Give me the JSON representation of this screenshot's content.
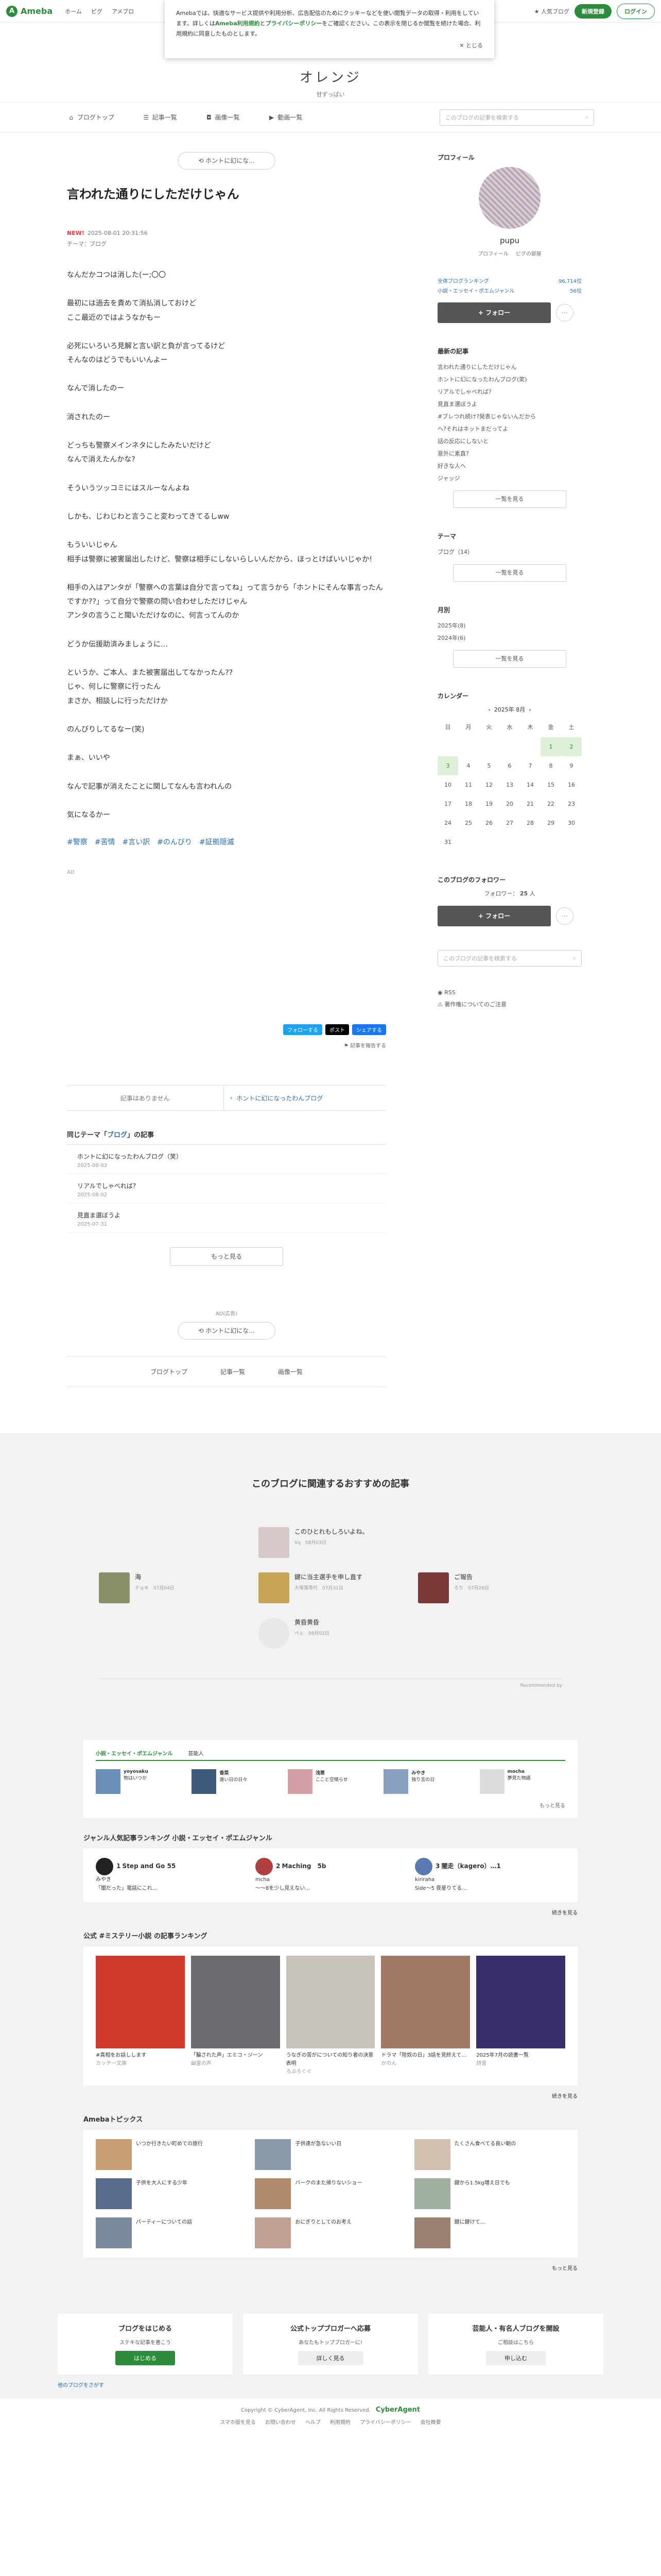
{
  "header": {
    "logo": "Ameba",
    "nav": [
      "ホーム",
      "ピグ",
      "アメブロ"
    ],
    "blogger_label": "人気ブログ",
    "signup": "新規登録",
    "login": "ログイン"
  },
  "cookie_banner": {
    "text_1": "Amebaでは、快適なサービス提供や利用分析、広告配信のためにクッキーなどを使い閲覧データの取得・利用をしています。詳しくは",
    "link_terms": "Ameba利用規約",
    "text_2": "と",
    "link_privacy": "プライバシーポリシー",
    "text_3": "をご確認ください。この表示を閉じるか閲覧を続けた場合、利用規約に同意したものとします。",
    "close": "とじる"
  },
  "blog": {
    "title": "オレンジ",
    "subtitle": "甘ずっぱい"
  },
  "blognav": {
    "items": [
      "ブログトップ",
      "記事一覧",
      "画像一覧",
      "動画一覧"
    ],
    "search_placeholder": "このブログの記事を検索する"
  },
  "entry": {
    "theme_button": "ホントに幻にな...",
    "title": "言われた通りにしただけじゃん",
    "new_badge": "NEW!",
    "date": "2025-08-01 20:31:56",
    "theme": "テーマ：ブログ",
    "paragraphs": [
      "なんだかコつは消した(ー;〇〇",
      "最初には過去を責めて消払消しておけど\nここ最近のではようなかもー",
      "必死にいろいろ見解と言い訳と負が言ってるけど\nそんなのはどうでもいいんよー",
      "なんで消したのー",
      "消されたのー",
      "どっちも警察メインネタにしたみたいだけど\nなんで消えたんかな?",
      "そういうツッコミにはスルーなんよね",
      "しかも、じわじわと言うこと変わってきてるしww",
      "もういいじゃん\n相手は警察に被害届出したけど、警察は相手にしないらしいんだから、ほっとけばいいじゃか!",
      "相手の入はアンタが「警察への言葉は自分で言ってね」って言うから「ホントにそんな事言ったんですか??」って自分で警察の問い合わせしただけじゃん\nアンタの言うこと聞いただけなのに、何言ってんのか",
      "どうか伝援助済みましょうに…",
      "というか、ご本人、また被害届出してなかったん??\nじゃ、何しに警察に行ったん\nまさか、相談しに行っただけか",
      "のんびりしてるなー(笑)",
      "まぁ、いいや",
      "なんで記事が消えたことに関してなんも言われんの",
      "気になるかー"
    ],
    "hashtags": [
      "#警察",
      "#苦情",
      "#言い訳",
      "#のんびり",
      "#証拠隠滅"
    ],
    "ad_label": "AD",
    "share": [
      "フォローする",
      "ポスト",
      "シェアする"
    ],
    "report": "記事を報告する",
    "prev": "記事はありません",
    "next": "ホントに幻になったわんブログ"
  },
  "same_theme": {
    "heading_prefix": "同じテーマ「",
    "heading_theme": "ブログ",
    "heading_suffix": "」の記事",
    "items": [
      {
        "title": "ホントに幻になったわんブログ（笑）",
        "date": "2025-08-03"
      },
      {
        "title": "リアルでしゃべれば?",
        "date": "2025-08-02"
      },
      {
        "title": "見直ま選ぼうよ",
        "date": "2025-07-31"
      }
    ],
    "more": "もっと見る"
  },
  "ad2_label": "AD(広告)",
  "bottom_nav": [
    "ブログトップ",
    "記事一覧",
    "画像一覧"
  ],
  "side": {
    "profile_heading": "プロフィール",
    "name": "pupu",
    "links": [
      "プロフィール",
      "ピグの部屋"
    ],
    "rank": [
      {
        "label": "全体ブログランキング",
        "value": "96,714位"
      },
      {
        "label": "小説・エッセイ・ポエムジャンル",
        "value": "56位"
      }
    ],
    "follow": "+ フォロー",
    "recent_heading": "最新の記事",
    "recent": [
      "言われた通りにしただけじゃん",
      "ホントに幻になったわんブログ(笑)",
      "リアルでしゃべれば?",
      "見直ま選ぼうよ",
      "#ブレつれ続け?発表じゃないんだから",
      "へ?それはネットまだってよ",
      "話の反応にしないと",
      "意外に素直?",
      "好きな人へ",
      "ジャッジ"
    ],
    "list_more": "一覧を見る",
    "theme_heading": "テーマ",
    "themes": [
      "ブログ（14）"
    ],
    "monthly_heading": "月別",
    "months": [
      "2025年(8)",
      "2024年(6)"
    ],
    "calendar_heading": "カレンダー",
    "calendar_month": "2025年 8月",
    "weekdays": [
      "日",
      "月",
      "火",
      "水",
      "木",
      "金",
      "土"
    ],
    "followers_heading": "このブログのフォロワー",
    "followers": "フォロワー：",
    "followers_count": "25",
    "followers_unit": "人",
    "search_placeholder": "このブログの記事を検索する",
    "rss": "RSS",
    "report": "著作権についてのご注意"
  },
  "recommend": {
    "heading": "このブログに関連するおすすめの記事",
    "items": [
      {
        "title": "このひとれもしろいよね。",
        "meta": "Vq　08月03日"
      },
      {
        "title": "海",
        "meta": "チョキ　07月04日"
      },
      {
        "title": "鍵に当主選手を申し直す",
        "meta": "大塚落帯代　07月31日"
      },
      {
        "title": "ご報告",
        "meta": "ろり　07月26日"
      },
      {
        "title": "黄昏黄昏",
        "meta": "ぺぇ　08月02日"
      }
    ],
    "credit": "Recommended by"
  },
  "portal": {
    "tabs": [
      "小説・エッセイ・ポエムジャンル",
      "芸能人"
    ],
    "tiles": [
      {
        "name": "yoyosaku",
        "text": "物はいつか"
      },
      {
        "name": "香菜",
        "text": "遠い日の日々"
      },
      {
        "name": "浅葱",
        "text": "ここと空晴らせ"
      },
      {
        "name": "みやき",
        "text": "独り言の日"
      },
      {
        "name": "mocha",
        "text": "夢見た物語"
      }
    ],
    "more": "もっと見る",
    "ranking_heading": "ジャンル人気記事ランキング 小説・エッセイ・ポエムジャンル",
    "ranking": [
      {
        "rank": "1",
        "title": "Step and Go 55",
        "author": "みやき",
        "text": "「闇だった」電話にこれ…"
      },
      {
        "rank": "2",
        "title": "Maching　5b",
        "author": "mcha",
        "text": "〜〜8を少し見えない…"
      },
      {
        "rank": "3",
        "title": "闇走（kagero）…1",
        "author": "kiriraha",
        "text": "Side〜5 夜星りてる…"
      }
    ],
    "ranking_more": "続きを見る",
    "public_heading": "公式 #ミステリー小説 の記事ランキング",
    "books": [
      {
        "title": "#真相をお話しします",
        "author": "カッチー文庫"
      },
      {
        "title": "「騙された声」エミコ・ジーン",
        "author": "幽霊の声"
      },
      {
        "title": "うなぎの苦がについての知り者の決意表明",
        "author": "ろぶろぐぐ"
      },
      {
        "title": "ドラマ「陸奴の日」3話を見終えて…",
        "author": "かのん"
      },
      {
        "title": "2025年7月の読書一覧",
        "author": "詩音"
      }
    ],
    "public_more": "続きを見る",
    "topics_heading": "Amebaトピックス",
    "topics": [
      "いつか行きたい町めての旅行",
      "子供達が急ないい日",
      "たくさん食べてる良い朝の",
      "子供を大人にする少年",
      "バークのまた帰りないショー",
      "鍵から1.5kg増え日でも",
      "パーティーについての話",
      "おにぎりとしてのお考え",
      "鍵に鍵けて…"
    ],
    "topics_more": "もっと見る"
  },
  "promo": [
    {
      "title": "ブログをはじめる",
      "text": "ステキな記事を書こう",
      "button": "はじめる"
    },
    {
      "title": "公式トップブロガーへ応募",
      "text": "あなたもトップブロガーに!",
      "button": "詳しく見る"
    },
    {
      "title": "芸能人・有名人ブログを開設",
      "text": "ご相談はこちら",
      "button": "申し込む"
    }
  ],
  "promo_link": "他のブログをさがす",
  "footer": {
    "copyright": "Copyright © CyberAgent, Inc. All Rights Reserved.",
    "company": "CyberAgent",
    "links": [
      "スマホ版を見る",
      "お問い合わせ",
      "ヘルプ",
      "利用規約",
      "プライバシーポリシー",
      "会社概要"
    ]
  }
}
